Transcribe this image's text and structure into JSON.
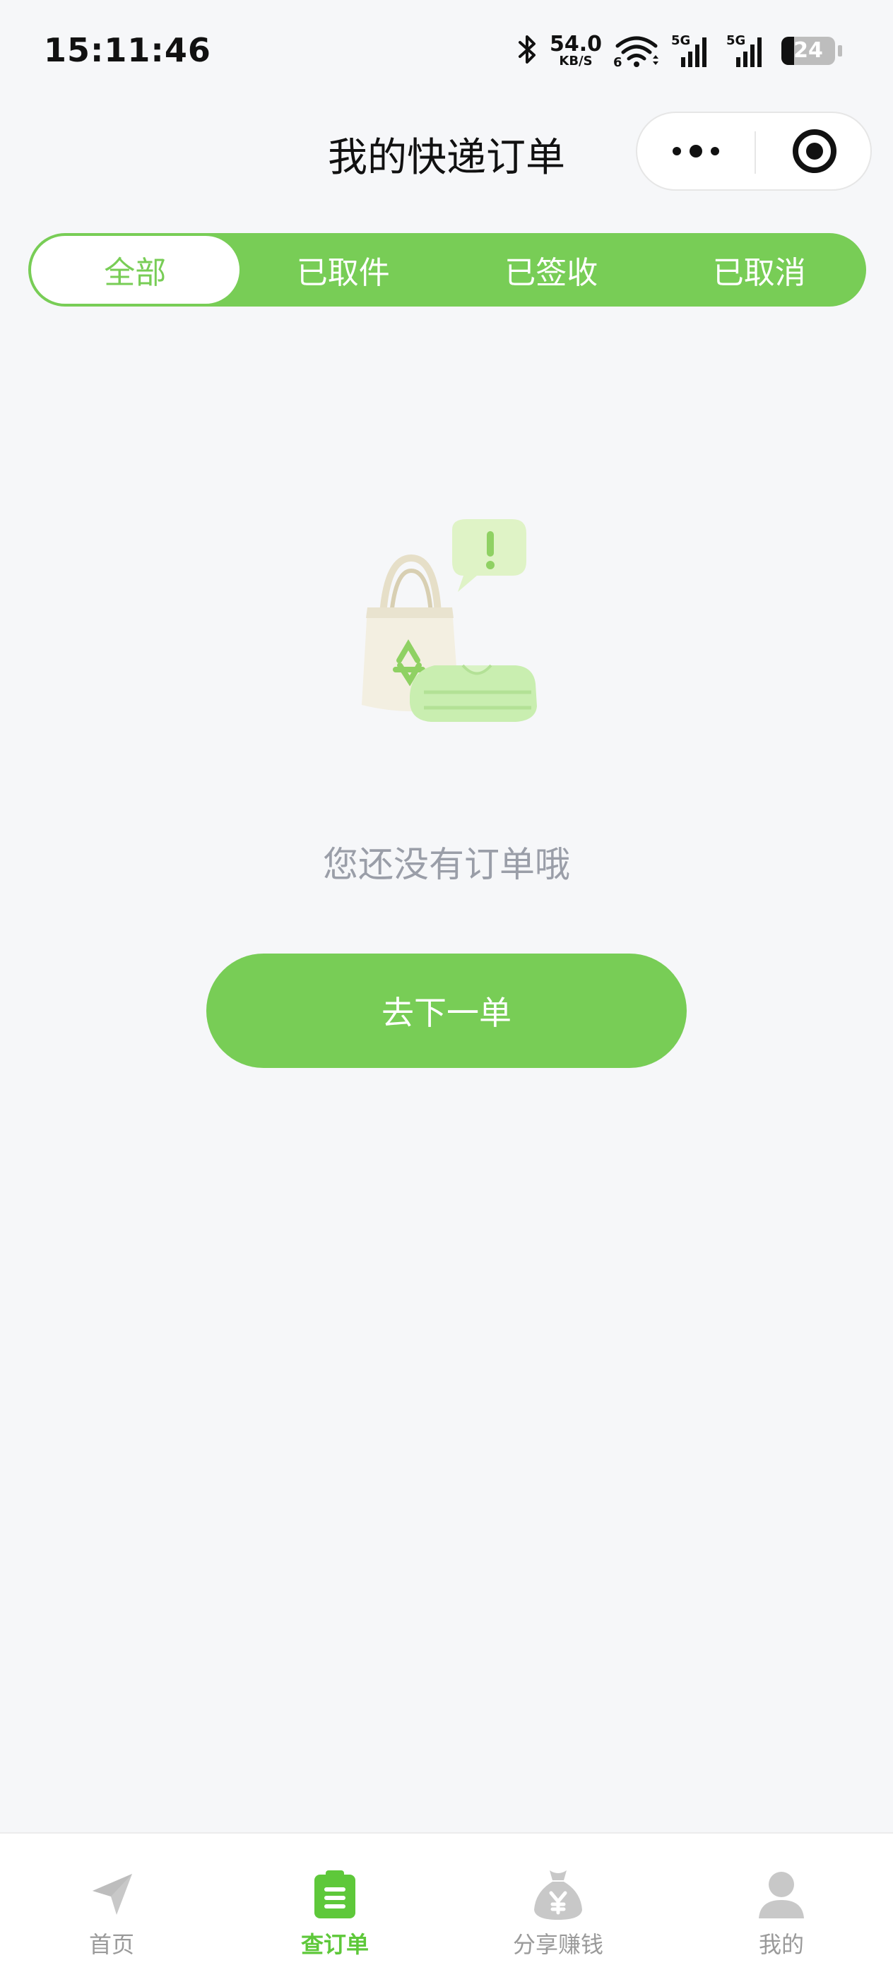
{
  "status_bar": {
    "time": "15:11:46",
    "net_speed_value": "54.0",
    "net_speed_unit": "KB/S",
    "wifi_label": "6",
    "sim1_label": "5G",
    "sim2_label": "5G",
    "battery_level": "24",
    "icons": [
      "bluetooth-icon",
      "wifi-icon",
      "signal-icon",
      "battery-icon"
    ]
  },
  "nav": {
    "title": "我的快递订单",
    "icons": [
      "more-dots-icon",
      "target-close-icon"
    ]
  },
  "tabs": [
    {
      "label": "全部",
      "active": true
    },
    {
      "label": "已取件",
      "active": false
    },
    {
      "label": "已签收",
      "active": false
    },
    {
      "label": "已取消",
      "active": false
    }
  ],
  "empty_state": {
    "message": "您还没有订单哦",
    "button_label": "去下一单",
    "illustration": "shopping-bag-clothes-illustration"
  },
  "tabbar": [
    {
      "label": "首页",
      "icon": "paper-plane-icon",
      "active": false
    },
    {
      "label": "查订单",
      "icon": "clipboard-icon",
      "active": true
    },
    {
      "label": "分享赚钱",
      "icon": "money-bag-icon",
      "active": false
    },
    {
      "label": "我的",
      "icon": "person-icon",
      "active": false
    }
  ],
  "colors": {
    "accent": "#78cd56",
    "accent_dark": "#5ec83a",
    "background": "#f6f7f9",
    "muted_text": "#9a9ea8",
    "tab_inactive": "#bdbdbd"
  }
}
